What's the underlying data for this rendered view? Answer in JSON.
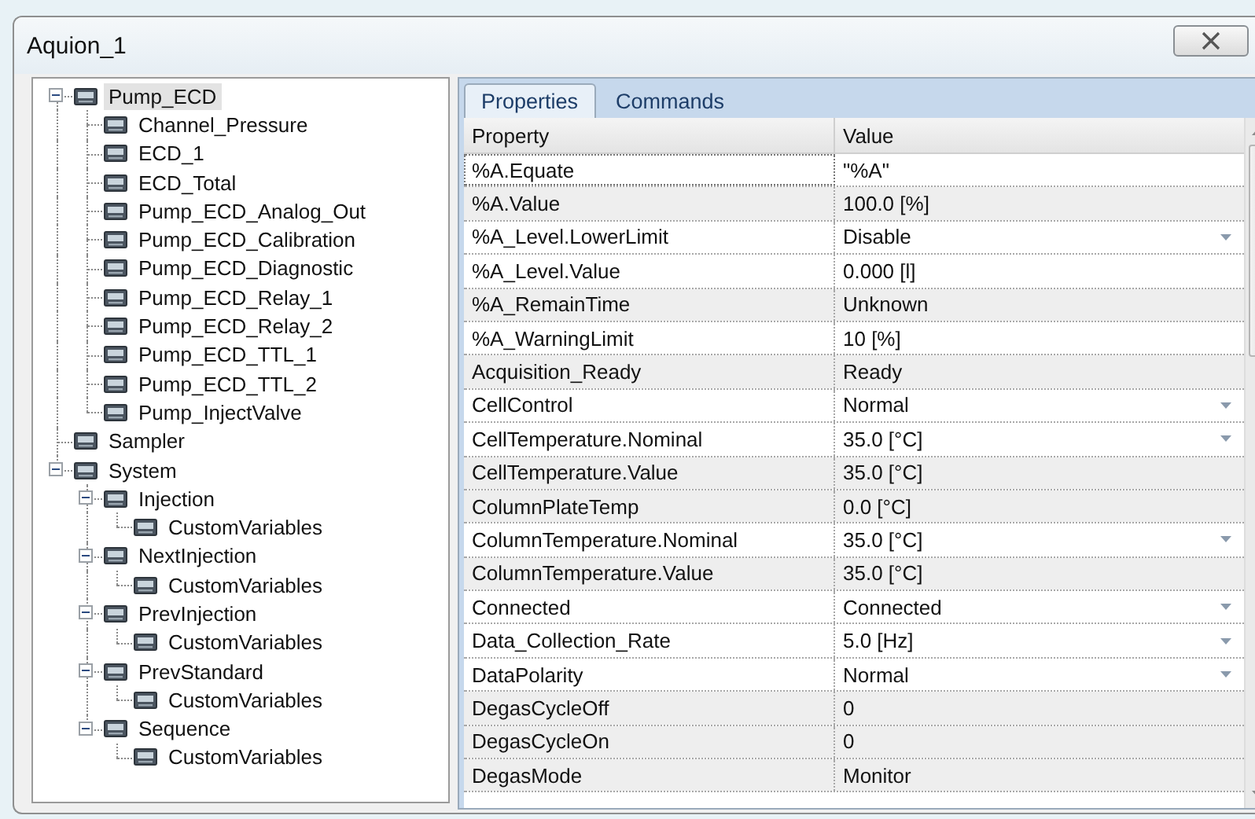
{
  "window": {
    "title": "Aquion_1"
  },
  "tree": [
    {
      "label": "Pump_ECD",
      "selected": true,
      "expanded": true,
      "children": [
        {
          "label": "Channel_Pressure",
          "selected": false
        },
        {
          "label": "ECD_1",
          "selected": false
        },
        {
          "label": "ECD_Total",
          "selected": false
        },
        {
          "label": "Pump_ECD_Analog_Out",
          "selected": false
        },
        {
          "label": "Pump_ECD_Calibration",
          "selected": false
        },
        {
          "label": "Pump_ECD_Diagnostic",
          "selected": false
        },
        {
          "label": "Pump_ECD_Relay_1",
          "selected": false
        },
        {
          "label": "Pump_ECD_Relay_2",
          "selected": false
        },
        {
          "label": "Pump_ECD_TTL_1",
          "selected": false
        },
        {
          "label": "Pump_ECD_TTL_2",
          "selected": false
        },
        {
          "label": "Pump_InjectValve",
          "selected": false
        }
      ]
    },
    {
      "label": "Sampler",
      "selected": false
    },
    {
      "label": "System",
      "selected": false,
      "expanded": true,
      "children": [
        {
          "label": "Injection",
          "selected": false,
          "expanded": true,
          "children": [
            {
              "label": "CustomVariables",
              "selected": false
            }
          ]
        },
        {
          "label": "NextInjection",
          "selected": false,
          "expanded": true,
          "children": [
            {
              "label": "CustomVariables",
              "selected": false
            }
          ]
        },
        {
          "label": "PrevInjection",
          "selected": false,
          "expanded": true,
          "children": [
            {
              "label": "CustomVariables",
              "selected": false
            }
          ]
        },
        {
          "label": "PrevStandard",
          "selected": false,
          "expanded": true,
          "children": [
            {
              "label": "CustomVariables",
              "selected": false
            }
          ]
        },
        {
          "label": "Sequence",
          "selected": false,
          "expanded": true,
          "children": [
            {
              "label": "CustomVariables",
              "selected": false
            }
          ]
        }
      ]
    }
  ],
  "tabs": [
    {
      "label": "Properties",
      "selected": true
    },
    {
      "label": "Commands",
      "selected": false
    }
  ],
  "table": {
    "columns": [
      "Property",
      "Value"
    ],
    "rows": [
      {
        "property": "%A.Equate",
        "value": "\"%A\"",
        "readonly": false,
        "dropdown": false
      },
      {
        "property": "%A.Value",
        "value": "100.0 [%]",
        "readonly": true,
        "dropdown": false
      },
      {
        "property": "%A_Level.LowerLimit",
        "value": "Disable",
        "readonly": false,
        "dropdown": true
      },
      {
        "property": "%A_Level.Value",
        "value": "0.000 [l]",
        "readonly": false,
        "dropdown": false
      },
      {
        "property": "%A_RemainTime",
        "value": "Unknown",
        "readonly": true,
        "dropdown": false
      },
      {
        "property": "%A_WarningLimit",
        "value": "10 [%]",
        "readonly": false,
        "dropdown": false
      },
      {
        "property": "Acquisition_Ready",
        "value": "Ready",
        "readonly": true,
        "dropdown": false
      },
      {
        "property": "CellControl",
        "value": "Normal",
        "readonly": false,
        "dropdown": true
      },
      {
        "property": "CellTemperature.Nominal",
        "value": "35.0 [°C]",
        "readonly": false,
        "dropdown": true
      },
      {
        "property": "CellTemperature.Value",
        "value": "35.0 [°C]",
        "readonly": true,
        "dropdown": false
      },
      {
        "property": "ColumnPlateTemp",
        "value": "0.0 [°C]",
        "readonly": true,
        "dropdown": false
      },
      {
        "property": "ColumnTemperature.Nominal",
        "value": "35.0 [°C]",
        "readonly": false,
        "dropdown": true
      },
      {
        "property": "ColumnTemperature.Value",
        "value": "35.0 [°C]",
        "readonly": true,
        "dropdown": false
      },
      {
        "property": "Connected",
        "value": "Connected",
        "readonly": false,
        "dropdown": true
      },
      {
        "property": "Data_Collection_Rate",
        "value": "5.0 [Hz]",
        "readonly": false,
        "dropdown": true
      },
      {
        "property": "DataPolarity",
        "value": "Normal",
        "readonly": false,
        "dropdown": true
      },
      {
        "property": "DegasCycleOff",
        "value": "0",
        "readonly": true,
        "dropdown": false
      },
      {
        "property": "DegasCycleOn",
        "value": "0",
        "readonly": true,
        "dropdown": false
      },
      {
        "property": "DegasMode",
        "value": "Monitor",
        "readonly": true,
        "dropdown": false
      }
    ]
  }
}
